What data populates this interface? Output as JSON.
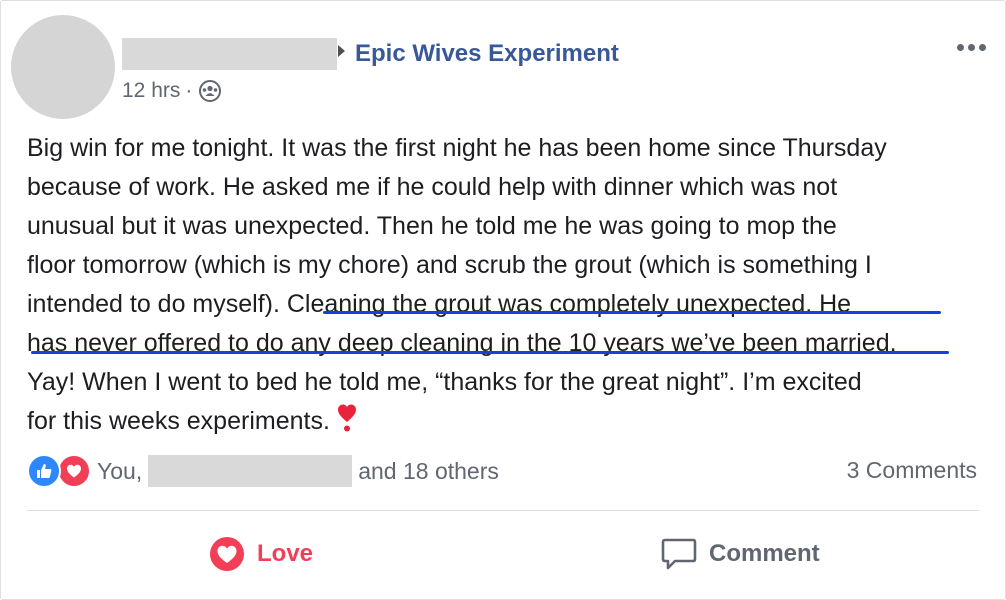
{
  "post": {
    "group_name": "Epic Wives Experiment",
    "time": "12 hrs",
    "separator": "·",
    "audience_icon": "group-audience-icon",
    "lines": [
      "Big win for me tonight. It was the first night he has been home since Thursday",
      "because of work. He asked me if he could help with dinner which was not",
      "unusual but it was unexpected. Then he told me he was going to mop the",
      "floor tomorrow (which is my chore) and scrub the grout (which is something I",
      "intended to do myself). Cleaning the grout was completely unexpected. He",
      "has never offered to do any deep cleaning in the 10 years we’ve been married.",
      "Yay! When I went to bed he told me, “thanks for the great night”. I’m excited",
      "for this weeks experiments."
    ],
    "emoji": "heart-exclamation-emoji"
  },
  "reactions": {
    "you_label": "You,",
    "others_label": "and 18 others",
    "comments_count": "3 Comments"
  },
  "actions": {
    "love_label": "Love",
    "comment_label": "Comment"
  },
  "colors": {
    "link": "#385898",
    "love": "#f33e58",
    "like": "#2d88ff",
    "underline": "#1a3fe0"
  }
}
